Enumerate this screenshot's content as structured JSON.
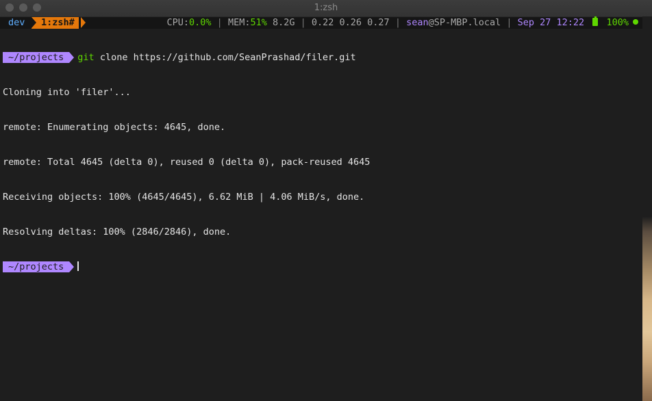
{
  "window": {
    "title": "1:zsh"
  },
  "statusbar": {
    "session": "dev",
    "window_label": "1:zsh#",
    "cpu_label": "CPU:",
    "cpu_value": "0.0%",
    "mem_label": "MEM:",
    "mem_value": "51%",
    "mem_size": "8.2G",
    "load": "0.22 0.26 0.27",
    "user": "sean",
    "host": "@SP-MBP.local",
    "datetime": "Sep 27 12:22",
    "battery": "100%",
    "colors": {
      "accent_orange": "#e5780b",
      "accent_green": "#5fd700",
      "accent_purple": "#af87ff",
      "accent_blue": "#5fafff"
    }
  },
  "terminal": {
    "prompt_path": "~/projects",
    "command_name": "git",
    "command_args": "clone https://github.com/SeanPrashad/filer.git",
    "output": [
      "Cloning into 'filer'...",
      "remote: Enumerating objects: 4645, done.",
      "remote: Total 4645 (delta 0), reused 0 (delta 0), pack-reused 4645",
      "Receiving objects: 100% (4645/4645), 6.62 MiB | 4.06 MiB/s, done.",
      "Resolving deltas: 100% (2846/2846), done."
    ],
    "prompt_path_2": "~/projects"
  }
}
